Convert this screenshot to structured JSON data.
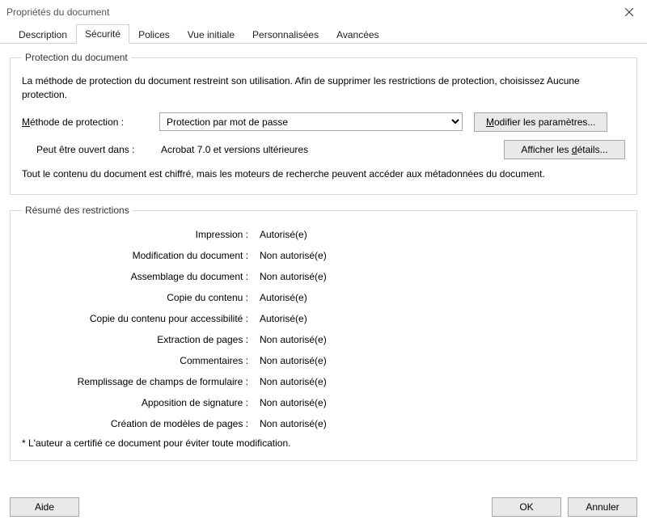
{
  "window": {
    "title": "Propriétés du document"
  },
  "tabs": {
    "description": "Description",
    "security": "Sécurité",
    "fonts": "Polices",
    "initial_view": "Vue initiale",
    "custom": "Personnalisées",
    "advanced": "Avancées"
  },
  "protection": {
    "legend": "Protection du document",
    "intro": "La méthode de protection du document restreint son utilisation. Afin de supprimer les restrictions de protection, choisissez Aucune protection.",
    "method_label_pre": "M",
    "method_label_post": "éthode de protection :",
    "method_value": "Protection par mot de passe",
    "modify_pre": "M",
    "modify_post": "odifier les paramètres...",
    "openin_label": "Peut être ouvert dans :",
    "openin_value": "Acrobat 7.0 et versions ultérieures",
    "details_pre": "Afficher les ",
    "details_u": "d",
    "details_post": "étails...",
    "encrypted_note": "Tout le contenu du document est chiffré, mais les moteurs de recherche peuvent accéder aux métadonnées du document."
  },
  "restrictions": {
    "legend": "Résumé des restrictions",
    "items": [
      {
        "k": "Impression :",
        "v": "Autorisé(e)"
      },
      {
        "k": "Modification du document :",
        "v": "Non autorisé(e)"
      },
      {
        "k": "Assemblage du document :",
        "v": "Non autorisé(e)"
      },
      {
        "k": "Copie du contenu :",
        "v": "Autorisé(e)"
      },
      {
        "k": "Copie du contenu pour accessibilité :",
        "v": "Autorisé(e)"
      },
      {
        "k": "Extraction de pages :",
        "v": "Non autorisé(e)"
      },
      {
        "k": "Commentaires :",
        "v": "Non autorisé(e)"
      },
      {
        "k": "Remplissage de champs de formulaire :",
        "v": "Non autorisé(e)"
      },
      {
        "k": "Apposition de signature :",
        "v": "Non autorisé(e)"
      },
      {
        "k": "Création de modèles de pages :",
        "v": "Non autorisé(e)"
      }
    ],
    "certified_note": "*   L'auteur a certifié ce document pour éviter toute modification."
  },
  "footer": {
    "help": "Aide",
    "ok": "OK",
    "cancel": "Annuler"
  }
}
